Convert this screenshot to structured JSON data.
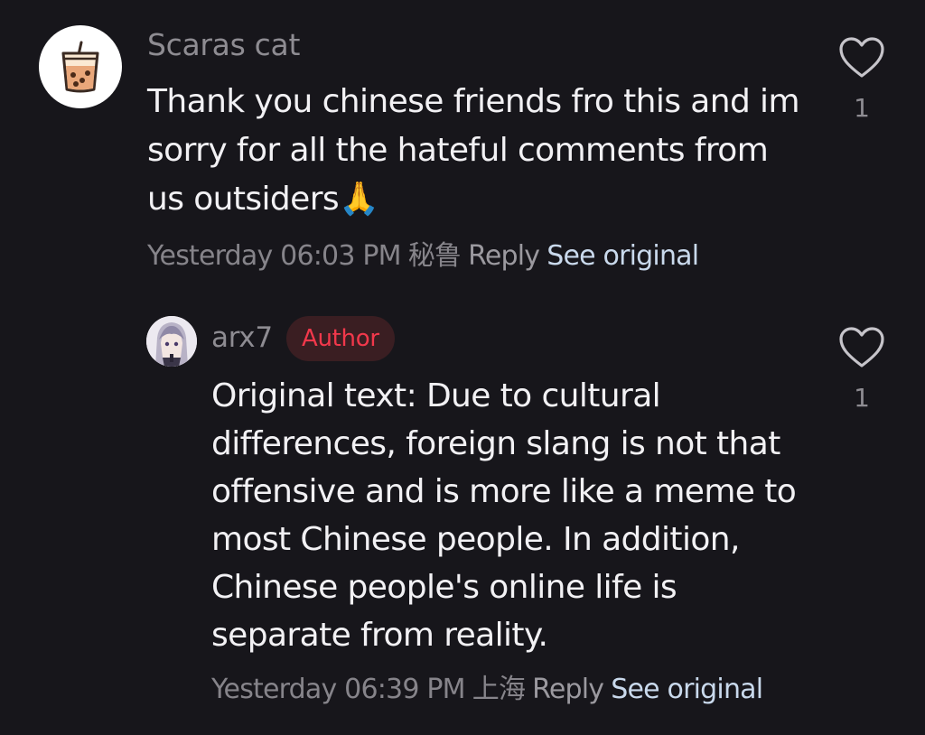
{
  "comments": [
    {
      "username": "Scaras cat",
      "avatar_icon": "bubble-tea-icon",
      "text": "Thank you chinese friends fro this and im sorry for all the hateful comments from us outsiders🙏",
      "timestamp": "Yesterday 06:03 PM",
      "location": "秘鲁",
      "reply_label": "Reply",
      "see_original_label": "See original",
      "like_count": "1"
    }
  ],
  "reply": {
    "username": "arx7",
    "badge": "Author",
    "avatar_icon": "anime-character-avatar",
    "text": "Original text: Due to cultural differences, foreign slang is not that offensive and is more like a meme to most Chinese people. In addition, Chinese people's online life is separate from reality.",
    "timestamp": "Yesterday 06:39 PM",
    "location": "上海",
    "reply_label": "Reply",
    "see_original_label": "See original",
    "like_count": "1"
  },
  "colors": {
    "background": "#17161b",
    "text_primary": "#f2f1f4",
    "text_secondary": "#8e8c92",
    "author_badge_text": "#f2384b",
    "author_badge_bg": "#3a1e22",
    "see_original": "#c9d9ec"
  }
}
